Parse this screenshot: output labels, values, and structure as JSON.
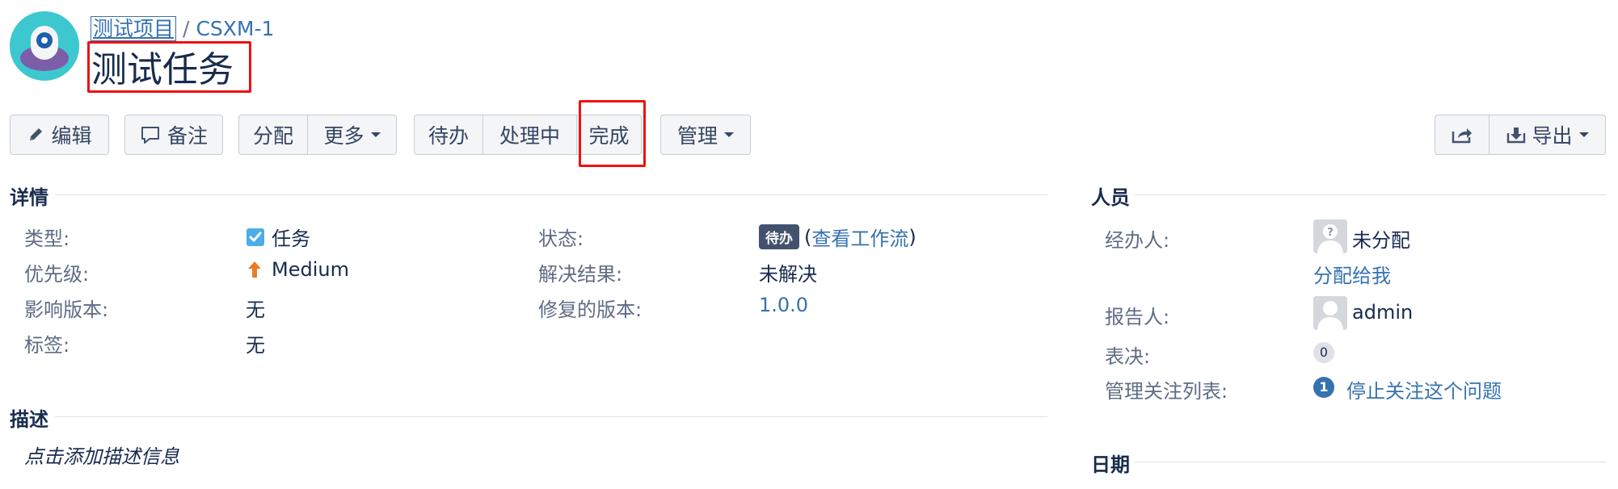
{
  "breadcrumb": {
    "project": "测试项目",
    "separator": "/",
    "issue_key": "CSXM-1"
  },
  "issue": {
    "title": "测试任务"
  },
  "toolbar": {
    "edit": "编辑",
    "comment": "备注",
    "assign": "分配",
    "more": "更多",
    "todo": "待办",
    "in_progress": "处理中",
    "done": "完成",
    "admin": "管理",
    "export": "导出"
  },
  "details": {
    "heading": "详情",
    "type_label": "类型:",
    "type_value": "任务",
    "priority_label": "优先级:",
    "priority_value": "Medium",
    "affects_label": "影响版本:",
    "affects_value": "无",
    "labels_label": "标签:",
    "labels_value": "无",
    "status_label": "状态:",
    "status_value": "待办",
    "workflow_open": "(",
    "workflow_link": "查看工作流",
    "workflow_close": ")",
    "resolution_label": "解决结果:",
    "resolution_value": "未解决",
    "fix_label": "修复的版本:",
    "fix_value": "1.0.0"
  },
  "description": {
    "heading": "描述",
    "placeholder": "点击添加描述信息"
  },
  "people": {
    "heading": "人员",
    "assignee_label": "经办人:",
    "assignee_value": "未分配",
    "assign_to_me": "分配给我",
    "reporter_label": "报告人:",
    "reporter_value": "admin",
    "votes_label": "表决:",
    "votes_count": "0",
    "watchers_label": "管理关注列表:",
    "watchers_count": "1",
    "stop_watching": "停止关注这个问题"
  },
  "dates": {
    "heading": "日期"
  },
  "colors": {
    "link": "#3572b0",
    "highlight": "#ee1111",
    "status_lozenge": "#42526e"
  }
}
